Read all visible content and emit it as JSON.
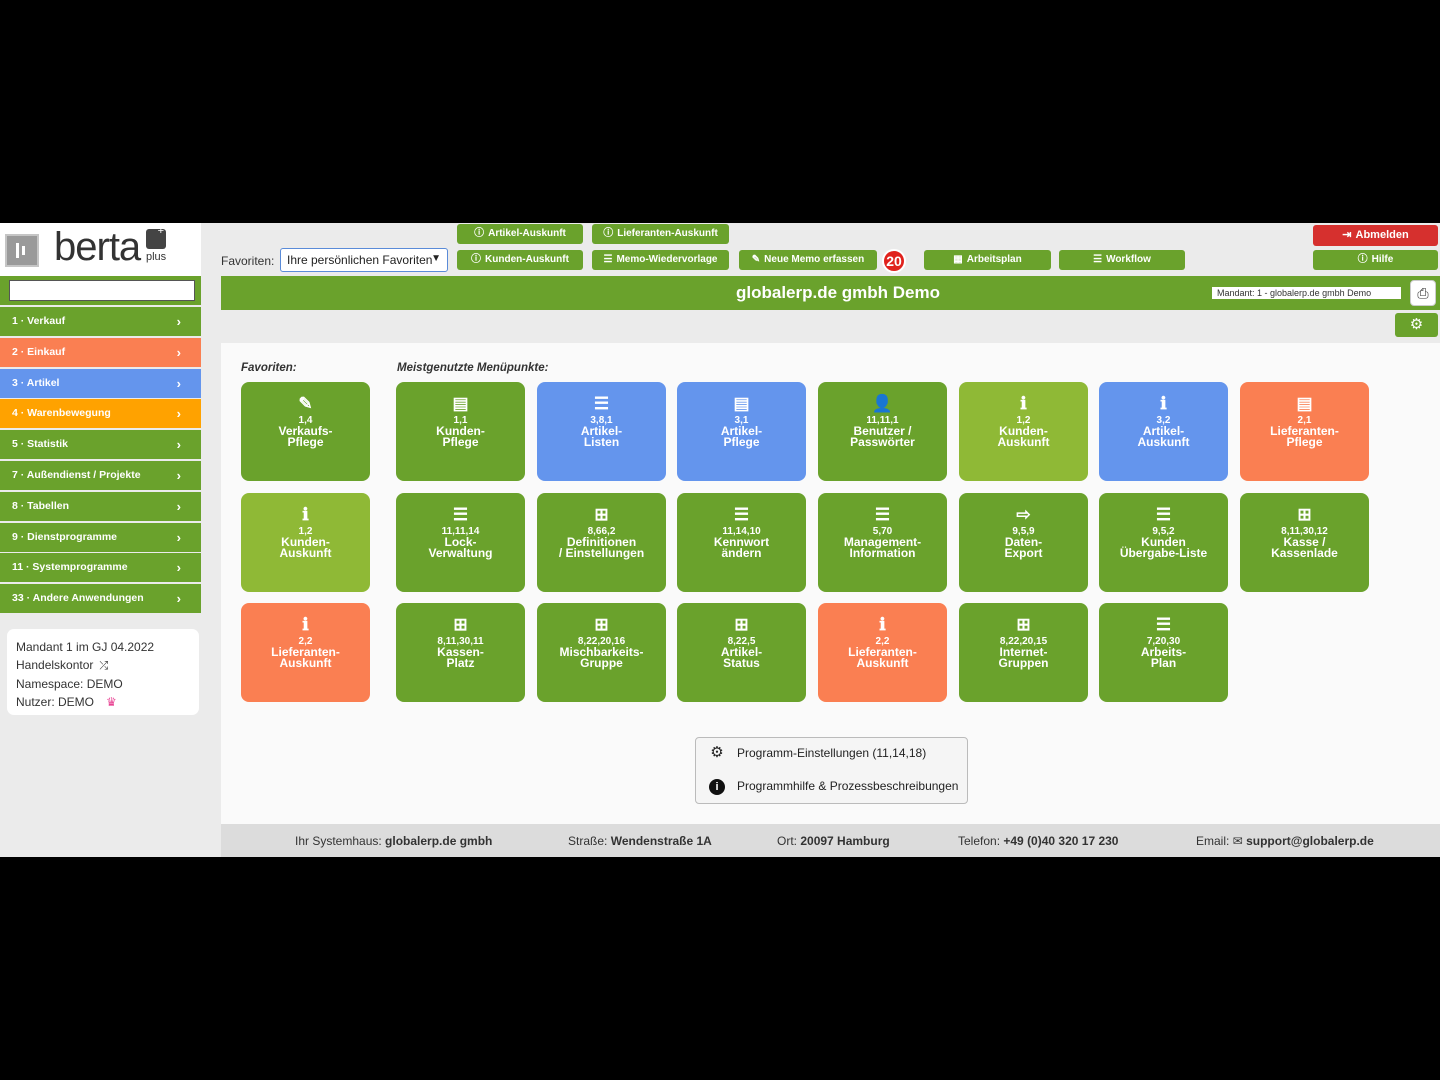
{
  "logo": {
    "word": "berta",
    "suffix": "plus"
  },
  "sidebar": {
    "search_value": "",
    "items": [
      {
        "label": "1 · Verkauf",
        "color": "#6aa22c"
      },
      {
        "label": "2 · Einkauf",
        "color": "#fa7f52"
      },
      {
        "label": "3 · Artikel",
        "color": "#6495ed"
      },
      {
        "label": "4 · Warenbewegung",
        "color": "#ffa200"
      },
      {
        "label": "5 · Statistik",
        "color": "#6aa22c"
      },
      {
        "label": "7 · Außendienst / Projekte",
        "color": "#6aa22c"
      },
      {
        "label": "8 · Tabellen",
        "color": "#6aa22c"
      },
      {
        "label": "9 · Dienstprogramme",
        "color": "#6aa22c"
      },
      {
        "label": "11 · Systemprogramme",
        "color": "#6aa22c"
      },
      {
        "label": "33 · Andere Anwendungen",
        "color": "#6aa22c"
      }
    ],
    "chevron": "›"
  },
  "mandant_card": {
    "mandant": "Mandant 1 im GJ 04.2022",
    "kontor": "Handelskontor",
    "namespace": "Namespace: DEMO",
    "nutzer": "Nutzer: DEMO"
  },
  "header": {
    "favorites_label": "Favoriten:",
    "favorites_select": "Ihre persönlichen Favoriten",
    "buttons": {
      "artikel_auskunft": "Artikel-Auskunft",
      "lieferanten_auskunft": "Lieferanten-Auskunft",
      "kunden_auskunft": "Kunden-Auskunft",
      "memo_wiedervorlage": "Memo-Wiedervorlage",
      "neue_memo": "Neue Memo erfassen",
      "arbeitsplan": "Arbeitsplan",
      "workflow": "Workflow",
      "abmelden": "Abmelden",
      "hilfe": "Hilfe"
    },
    "memo_count": "20",
    "company_title": "globalerp.de gmbh Demo",
    "mandant_tag": "Mandant: 1 - globalerp.de gmbh Demo"
  },
  "main": {
    "favorites_heading": "Favoriten:",
    "most_used_heading": "Meistgenutzte Menüpunkte:",
    "favorites_tiles": [
      {
        "icon": "✎",
        "icon_name": "pencil-icon",
        "code": "1,4",
        "label": "Verkaufs-\nPflege",
        "color": "green"
      },
      {
        "icon": "ℹ",
        "icon_name": "info-icon",
        "code": "1,2",
        "label": "Kunden-\nAuskunft",
        "color": "lime"
      },
      {
        "icon": "ℹ",
        "icon_name": "info-icon",
        "code": "2,2",
        "label": "Lieferanten-\nAuskunft",
        "color": "orange"
      }
    ],
    "most_used_tiles": [
      {
        "icon": "▤",
        "icon_name": "list-alt-icon",
        "code": "1,1",
        "label": "Kunden-\nPflege",
        "color": "green"
      },
      {
        "icon": "☰",
        "icon_name": "list-icon",
        "code": "3,8,1",
        "label": "Artikel-\nListen",
        "color": "blue"
      },
      {
        "icon": "▤",
        "icon_name": "list-alt-icon",
        "code": "3,1",
        "label": "Artikel-\nPflege",
        "color": "blue"
      },
      {
        "icon": "👤",
        "icon_name": "user-icon",
        "code": "11,11,1",
        "label": "Benutzer /\nPasswörter",
        "color": "green"
      },
      {
        "icon": "ℹ",
        "icon_name": "info-icon",
        "code": "1,2",
        "label": "Kunden-\nAuskunft",
        "color": "lime"
      },
      {
        "icon": "ℹ",
        "icon_name": "info-icon",
        "code": "3,2",
        "label": "Artikel-\nAuskunft",
        "color": "blue"
      },
      {
        "icon": "▤",
        "icon_name": "list-alt-icon",
        "code": "2,1",
        "label": "Lieferanten-\nPflege",
        "color": "orange"
      },
      {
        "icon": "☰",
        "icon_name": "bars-icon",
        "code": "11,11,14",
        "label": "Lock-\nVerwaltung",
        "color": "green"
      },
      {
        "icon": "⊞",
        "icon_name": "table-icon",
        "code": "8,66,2",
        "label": "Definitionen\n/ Einstellungen",
        "color": "green"
      },
      {
        "icon": "☰",
        "icon_name": "bars-icon",
        "code": "11,14,10",
        "label": "Kennwort\nändern",
        "color": "green"
      },
      {
        "icon": "☰",
        "icon_name": "list-icon",
        "code": "5,70",
        "label": "Management-\nInformation",
        "color": "green"
      },
      {
        "icon": "⇨",
        "icon_name": "file-export-icon",
        "code": "9,5,9",
        "label": "Daten-\nExport",
        "color": "green"
      },
      {
        "icon": "☰",
        "icon_name": "list-icon",
        "code": "9,5,2",
        "label": "Kunden\nÜbergabe-Liste",
        "color": "green"
      },
      {
        "icon": "⊞",
        "icon_name": "table-icon",
        "code": "8,11,30,12",
        "label": "Kasse /\nKassenlade",
        "color": "green"
      },
      {
        "icon": "⊞",
        "icon_name": "table-icon",
        "code": "8,11,30,11",
        "label": "Kassen-\nPlatz",
        "color": "green"
      },
      {
        "icon": "⊞",
        "icon_name": "table-icon",
        "code": "8,22,20,16",
        "label": "Mischbarkeits-\nGruppe",
        "color": "green"
      },
      {
        "icon": "⊞",
        "icon_name": "table-icon",
        "code": "8,22,5",
        "label": "Artikel-\nStatus",
        "color": "green"
      },
      {
        "icon": "ℹ",
        "icon_name": "info-icon",
        "code": "2,2",
        "label": "Lieferanten-\nAuskunft",
        "color": "orange"
      },
      {
        "icon": "⊞",
        "icon_name": "table-icon",
        "code": "8,22,20,15",
        "label": "Internet-\nGruppen",
        "color": "green"
      },
      {
        "icon": "☰",
        "icon_name": "bars-icon",
        "code": "7,20,30",
        "label": "Arbeits-\nPlan",
        "color": "green"
      }
    ],
    "help": {
      "settings": "Programm-Einstellungen (11,14,18)",
      "docs": "Programmhilfe & Prozessbeschreibungen"
    }
  },
  "footer": {
    "systemhaus_label": "Ihr Systemhaus:",
    "systemhaus": "globalerp.de gmbh",
    "strasse_label": "Straße:",
    "strasse": "Wendenstraße 1A",
    "ort_label": "Ort:",
    "ort": "20097 Hamburg",
    "telefon_label": "Telefon:",
    "telefon": "+49 (0)40 320 17 230",
    "email_label": "Email:",
    "email": "support@globalerp.de"
  }
}
